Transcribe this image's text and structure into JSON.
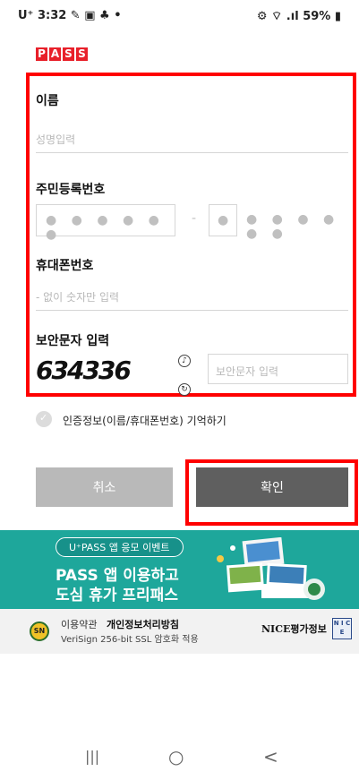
{
  "status_bar": {
    "time": "U⁺ 3:32 ✎ ▣ ♣ •",
    "battery": "59%",
    "right_icons": "⚙ ⌔ .ıl"
  },
  "logo": {
    "letters": [
      "P",
      "A",
      "S",
      "S"
    ]
  },
  "form": {
    "name_label": "이름",
    "name_placeholder": "성명입력",
    "rrn_label": "주민등록번호",
    "rrn_first_dots": "● ● ● ● ● ●",
    "rrn_dash": "-",
    "rrn_second_first_dot": "●",
    "rrn_second_dots": "● ● ● ● ● ●",
    "phone_label": "휴대폰번호",
    "phone_placeholder": "- 없이 숫자만 입력",
    "captcha_label": "보안문자 입력",
    "captcha_text": "634336",
    "captcha_input_placeholder": "보안문자 입력"
  },
  "remember": {
    "label": "인증정보(이름/휴대폰번호) 기억하기"
  },
  "buttons": {
    "cancel": "취소",
    "confirm": "확인"
  },
  "banner": {
    "pill": "U⁺PASS 앱 응모 이벤트",
    "line1": "PASS 앱 이용하고",
    "line2": "도심 휴가 프리패스"
  },
  "footer": {
    "badge": "SN",
    "terms": "이용약관",
    "privacy": "개인정보처리방침",
    "ssl": "VeriSign 256-bit SSL 암호화 적용",
    "nice": "NICE평가정보",
    "nice_logo": "N I C E"
  },
  "navbar": {
    "recent": "|||",
    "home": "○",
    "back": "<"
  },
  "colors": {
    "accent_red": "#e8202a",
    "highlight": "#ff0000",
    "banner": "#1ea79b",
    "confirm": "#5f5f5f",
    "cancel": "#b9b9b9"
  }
}
